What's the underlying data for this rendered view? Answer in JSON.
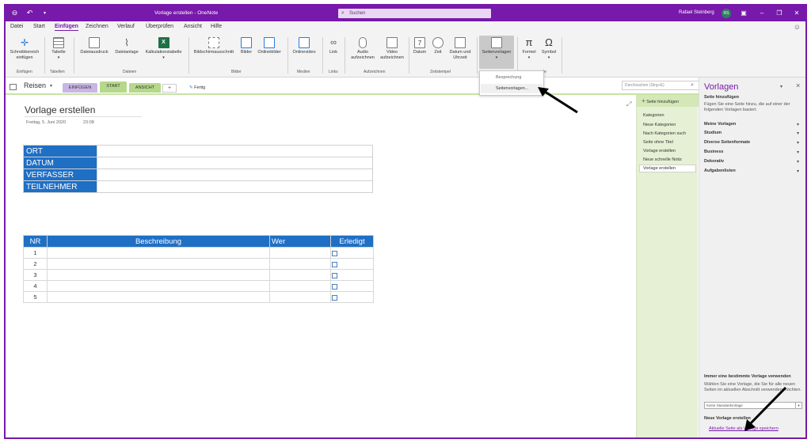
{
  "window": {
    "title": "Vorlage erstellen - OneNote",
    "search_placeholder": "Suchen",
    "user_name": "Rafael Steinberg",
    "user_initials": "RS",
    "accent": "#7719aa"
  },
  "menu": {
    "items": [
      "Datei",
      "Start",
      "Einfügen",
      "Zeichnen",
      "Verlauf",
      "Überprüfen",
      "Ansicht",
      "Hilfe"
    ],
    "active": "Einfügen"
  },
  "ribbon": {
    "buttons": {
      "schreibbereich_1": "Schreibbereich",
      "schreibbereich_2": "einfügen",
      "tabelle": "Tabelle",
      "dateiausdruck": "Dateiausdruck",
      "dateianlage": "Dateianlage",
      "kalkulation": "Kalkulationstabelle",
      "bildschirmausschnitt": "Bildschirmausschnitt",
      "bilder": "Bilder",
      "onlinebilder": "Onlinebilder",
      "onlinevideo": "Onlinevideo",
      "link": "Link",
      "audio_1": "Audio",
      "audio_2": "aufzeichnen",
      "video_1": "Video",
      "video_2": "aufzeichnen",
      "datum": "Datum",
      "zeit": "Zeit",
      "datum_uhrzeit_1": "Datum und",
      "datum_uhrzeit_2": "Uhrzeit",
      "seitenvorlagen": "Seitenvorlagen",
      "formel": "Formel",
      "symbol": "Symbol"
    },
    "groups": {
      "einfuegen": "Einfügen",
      "tabellen": "Tabellen",
      "dateien": "Dateien",
      "bilder": "Bilder",
      "medien": "Medien",
      "links": "Links",
      "aufzeichnen": "Aufzeichnen",
      "zeitstempel": "Zeitstempel",
      "symbole_suffix": "le"
    }
  },
  "dropdown": {
    "item1": "Besprechung",
    "item2": "Seitenvorlagen..."
  },
  "notebook": {
    "name": "Reisen",
    "tabs": [
      {
        "label": "EINFÜGEN",
        "color": "#c9b6e4"
      },
      {
        "label": "START",
        "color": "#b5d88a"
      },
      {
        "label": "ANSICHT",
        "color": "#b5d88a"
      }
    ],
    "plus": "+",
    "fertig": "Fertig",
    "search_placeholder": "Durchsuchen (Strg+E)"
  },
  "page": {
    "title": "Vorlage erstellen",
    "date": "Freitag, 5. Juni 2020",
    "time": "23:08",
    "info_rows": [
      "ORT",
      "DATUM",
      "VERFASSER",
      "TEILNEHMER"
    ],
    "task_headers": [
      "NR",
      "Beschreibung",
      "Wer",
      "Erledigt"
    ],
    "task_rows": [
      "1",
      "2",
      "3",
      "4",
      "5"
    ]
  },
  "pagelist": {
    "add_label": "Seite hinzufügen",
    "items": [
      "Kategorien",
      "Neue Kategorien",
      "Nach Kategorien such",
      "Seite ohne Titel",
      "Vorlage erstellen",
      "Neue schnelle Notiz",
      "Vorlage erstellen"
    ]
  },
  "vorlagen": {
    "title": "Vorlagen",
    "add_header": "Seite hinzufügen",
    "add_desc": "Fügen Sie eine Seite hinzu, die auf einer der folgenden Vorlagen basiert.",
    "categories": [
      "Meine Vorlagen",
      "Studium",
      "Diverse Seitenformate",
      "Business",
      "Dekorativ",
      "Aufgabenlisten"
    ],
    "default_header": "Immer eine bestimmte Vorlage verwenden",
    "default_desc": "Wählen Sie eine Vorlage, die Sie für alle neuen Seiten im aktuellen Abschnitt verwenden möchten.",
    "default_select": "Keine Standardvorlage",
    "new_header": "Neue Vorlage erstellen",
    "save_link": "Aktuelle Seite als Vorlage speichern"
  }
}
